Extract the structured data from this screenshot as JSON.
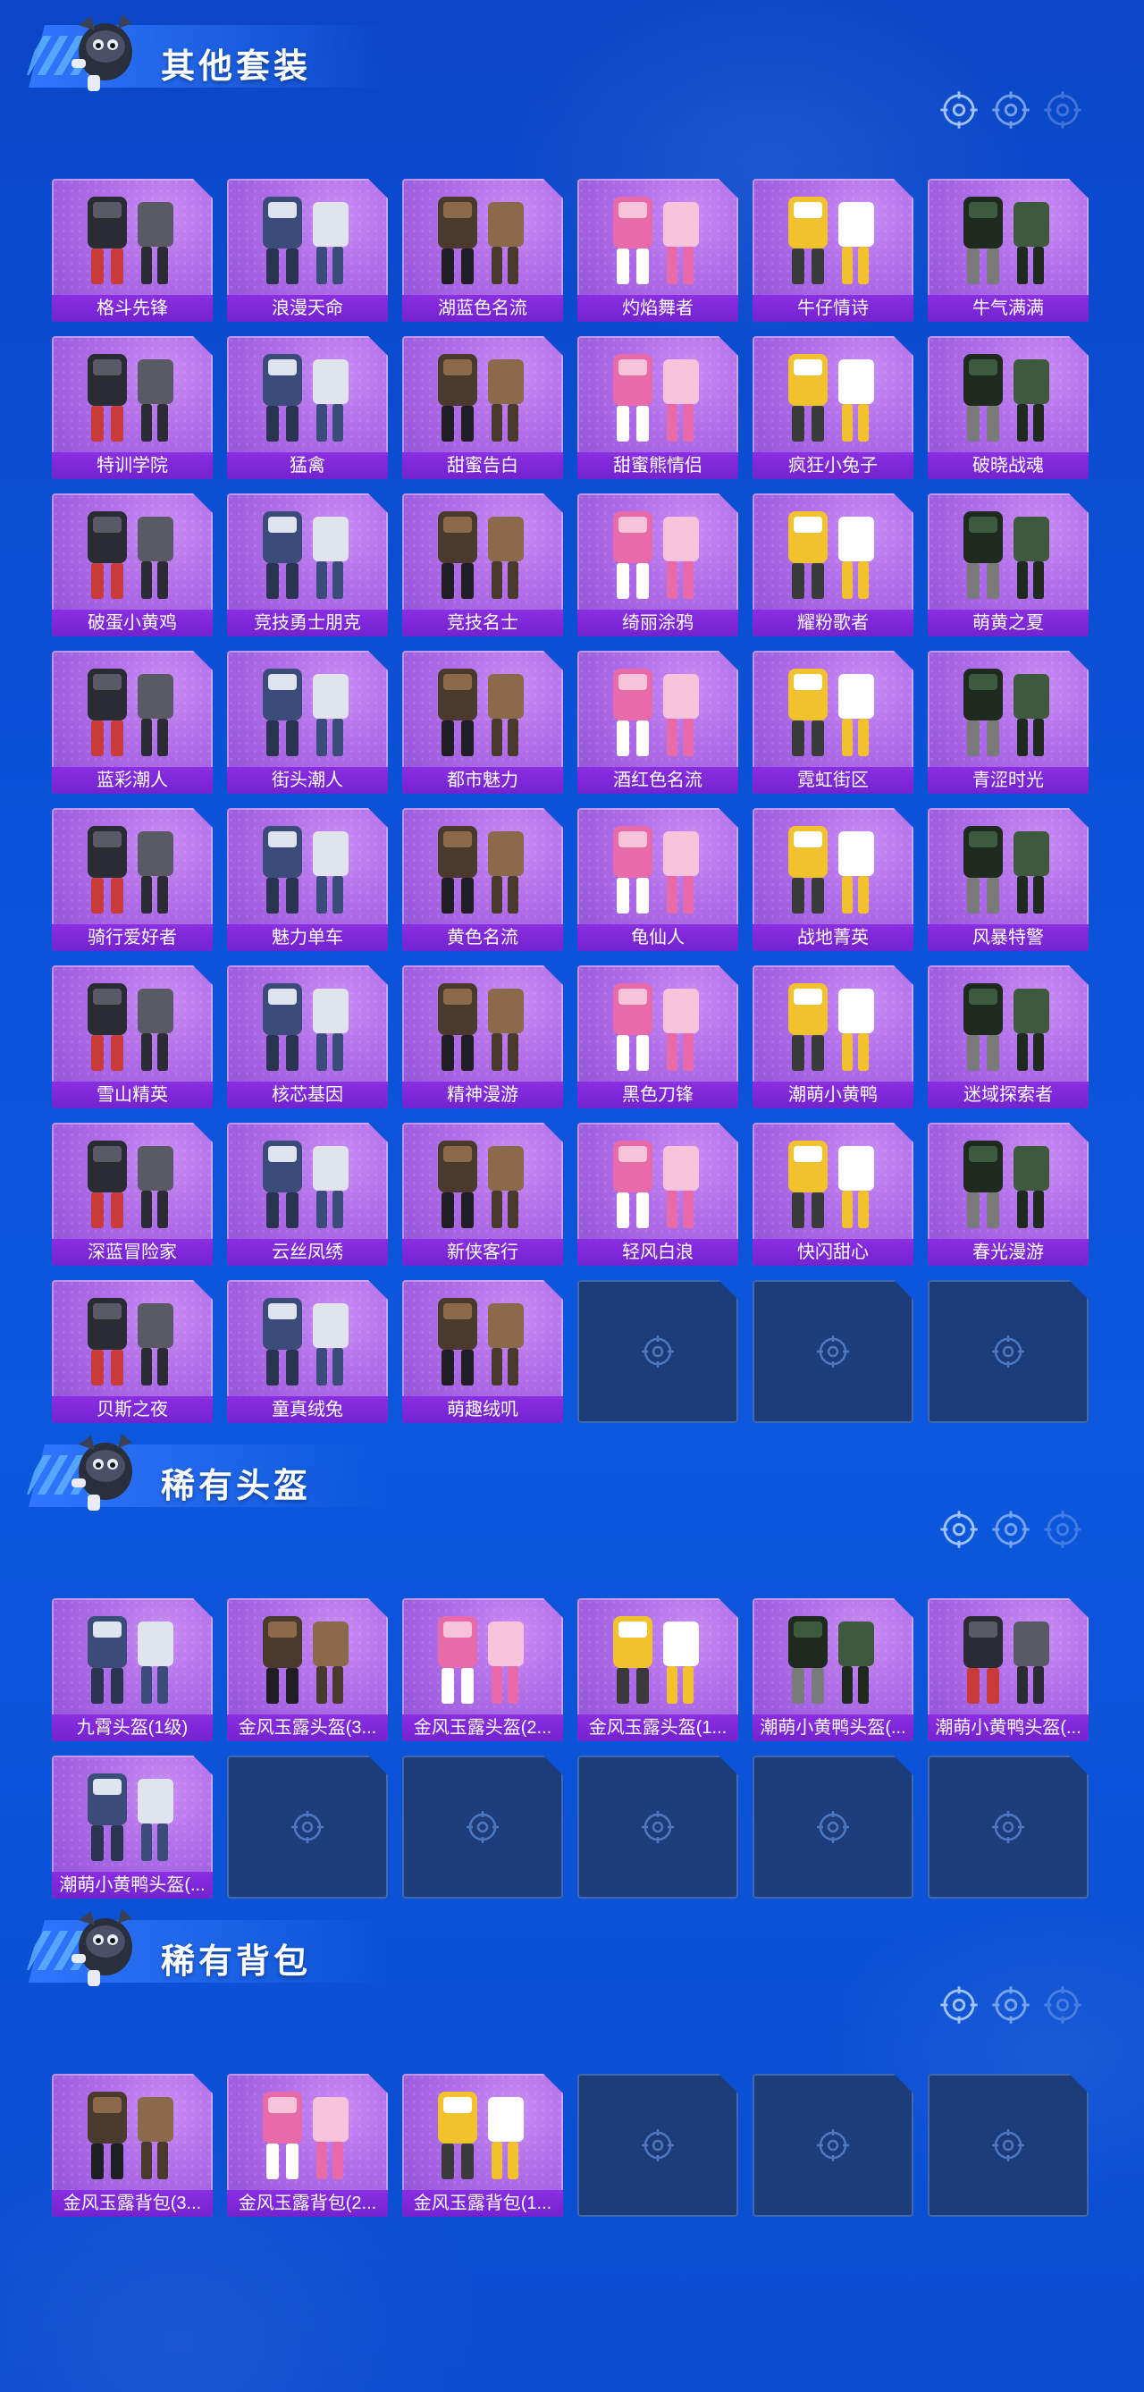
{
  "colors": {
    "background": "#0b52d8",
    "card_purple": "#b06ee8",
    "label_purple": "#7c26d6",
    "empty_slot": "#1c3c7a",
    "title_text": "#ffffff"
  },
  "icons": {
    "mascot": "mascot-icon",
    "target": "target-icon"
  },
  "sections": [
    {
      "title": "其他套装",
      "items": [
        "格斗先锋",
        "浪漫天命",
        "湖蓝色名流",
        "灼焰舞者",
        "牛仔情诗",
        "牛气满满",
        "特训学院",
        "猛禽",
        "甜蜜告白",
        "甜蜜熊情侣",
        "疯狂小兔子",
        "破晓战魂",
        "破蛋小黄鸡",
        "竞技勇士朋克",
        "竞技名士",
        "绮丽涂鸦",
        "耀粉歌者",
        "萌黄之夏",
        "蓝彩潮人",
        "街头潮人",
        "都市魅力",
        "酒红色名流",
        "霓虹街区",
        "青涩时光",
        "骑行爱好者",
        "魅力单车",
        "黄色名流",
        "龟仙人",
        "战地菁英",
        "风暴特警",
        "雪山精英",
        "核芯基因",
        "精神漫游",
        "黑色刀锋",
        "潮萌小黄鸭",
        "迷域探索者",
        "深蓝冒险家",
        "云丝凤绣",
        "新侠客行",
        "轻风白浪",
        "快闪甜心",
        "春光漫游",
        "贝斯之夜",
        "童真绒兔",
        "萌趣绒叽"
      ],
      "empty_slots": 3
    },
    {
      "title": "稀有头盔",
      "items": [
        "九霄头盔(1级)",
        "金风玉露头盔(3...",
        "金风玉露头盔(2...",
        "金风玉露头盔(1...",
        "潮萌小黄鸭头盔(...",
        "潮萌小黄鸭头盔(...",
        "潮萌小黄鸭头盔(..."
      ],
      "empty_slots": 5
    },
    {
      "title": "稀有背包",
      "items": [
        "金风玉露背包(3...",
        "金风玉露背包(2...",
        "金风玉露背包(1..."
      ],
      "empty_slots": 3
    }
  ]
}
